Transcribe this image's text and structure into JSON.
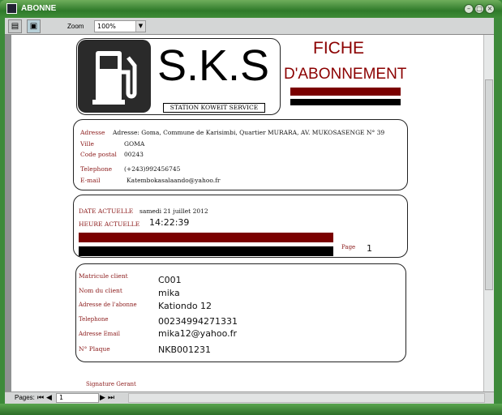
{
  "window": {
    "title": "ABONNE"
  },
  "toolbar": {
    "zoom_label": "Zoom",
    "zoom_value": "100%"
  },
  "report": {
    "logo_text": "S.K.S",
    "logo_subtitle": "STATION KOWEIT SERVICE",
    "title_line1": "FICHE",
    "title_line2": "D'ABONNEMENT",
    "company": [
      {
        "label": "Adresse",
        "value": "Adresse: Goma, Commune de Karisimbi, Quartier MURARA, AV. MUKOSASENGE N° 39"
      },
      {
        "label": "Ville",
        "value": "GOMA"
      },
      {
        "label": "Code postal",
        "value": "00243"
      },
      {
        "label": "Telephone",
        "value": "(+243)992456745"
      },
      {
        "label": "E-mail",
        "value": "Katembokasalaando@yahoo.fr"
      }
    ],
    "date_label": "DATE ACTUELLE",
    "date_value": "samedi 21 juillet 2012",
    "time_label": "HEURE ACTUELLE",
    "time_value": "14:22:39",
    "page_label": "Page",
    "page_value": "1",
    "client": [
      {
        "label": "Matricule client",
        "value": "C001"
      },
      {
        "label": "Nom du client",
        "value": "mika"
      },
      {
        "label": "Adresse de l'abonne",
        "value": "Kationdo 12"
      },
      {
        "label": "Telephone",
        "value": "00234994271331"
      },
      {
        "label": "Adresse Email",
        "value": "mika12@yahoo.fr"
      },
      {
        "label": "N° Plaque",
        "value": "NKB001231"
      }
    ],
    "signature_label": "Signature Gerant"
  },
  "pager": {
    "label": "Pages:",
    "current": "1"
  },
  "colors": {
    "accent": "#8b0000",
    "frame": "#3d8a3a"
  }
}
